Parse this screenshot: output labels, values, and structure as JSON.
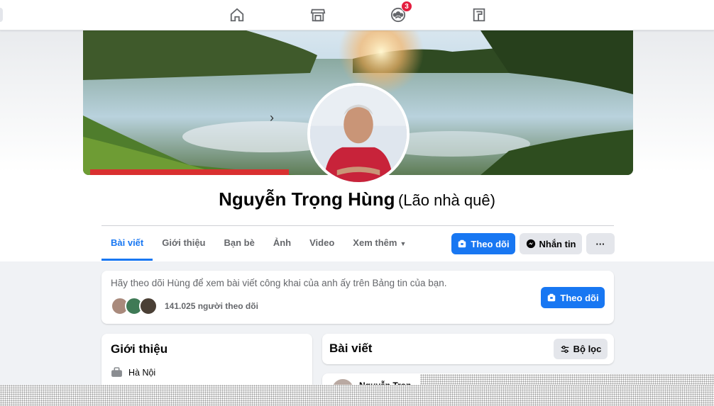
{
  "nav": {
    "icons": [
      "home-icon",
      "marketplace-icon",
      "groups-icon",
      "gaming-icon"
    ],
    "groups_badge": "3"
  },
  "profile": {
    "name": "Nguyễn Trọng Hùng",
    "alt_name": "(Lão nhà quê)"
  },
  "tabs": [
    {
      "label": "Bài viết",
      "active": true
    },
    {
      "label": "Giới thiệu"
    },
    {
      "label": "Bạn bè"
    },
    {
      "label": "Ảnh"
    },
    {
      "label": "Video"
    },
    {
      "label": "Xem thêm"
    }
  ],
  "actions": {
    "follow_label": "Theo dõi",
    "message_label": "Nhắn tin",
    "more_label": "···"
  },
  "follow_card": {
    "text": "Hãy theo dõi Hùng để xem bài viết công khai của anh ấy trên Bảng tin của bạn.",
    "followers": "141.025 người theo dõi",
    "follow_label": "Theo dõi"
  },
  "intro": {
    "title": "Giới thiệu",
    "location": "Hà Nội"
  },
  "posts": {
    "title": "Bài viết",
    "filter_label": "Bộ lọc",
    "first_author": "Nguyễn Trọn"
  },
  "colors": {
    "accent": "#1877f2",
    "badge": "#e41e3f"
  }
}
